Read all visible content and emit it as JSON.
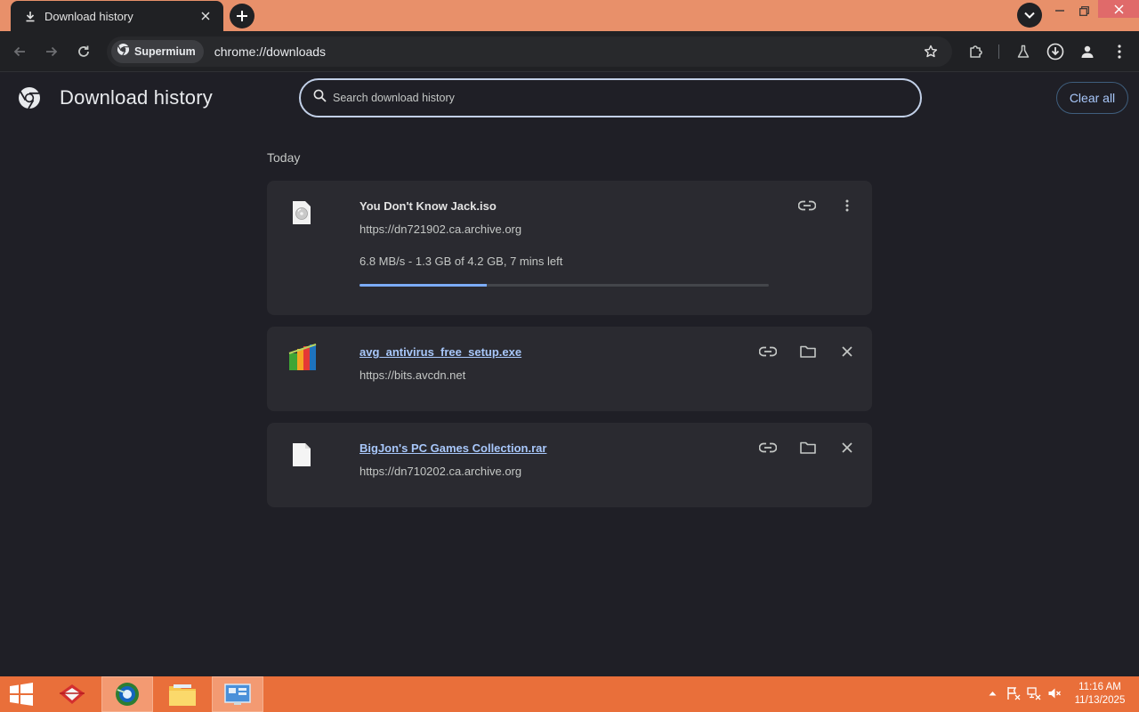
{
  "tab": {
    "title": "Download history"
  },
  "toolbar": {
    "chip_label": "Supermium",
    "url": "chrome://downloads"
  },
  "header": {
    "title": "Download history",
    "search_placeholder": "Search download history",
    "clear_all": "Clear all"
  },
  "section": {
    "title": "Today"
  },
  "downloads": [
    {
      "filename": "You Don't Know Jack.iso",
      "url": "https://dn721902.ca.archive.org",
      "progress_text": "6.8 MB/s - 1.3 GB of 4.2 GB, 7 mins left",
      "progress_fraction": 0.31,
      "in_progress": true
    },
    {
      "filename": "avg_antivirus_free_setup.exe",
      "url": "https://bits.avcdn.net",
      "in_progress": false
    },
    {
      "filename": "BigJon's PC Games Collection.rar",
      "url": "https://dn710202.ca.archive.org",
      "in_progress": false
    }
  ],
  "taskbar": {
    "time": "11:16 AM",
    "date": "11/13/2025"
  },
  "colors": {
    "titlebar": "#e8906a",
    "page_bg": "#1f1f26",
    "card_bg": "#2a2a30",
    "link": "#a8c7fa",
    "progress": "#7cacf8",
    "taskbar": "#e96f3a"
  }
}
